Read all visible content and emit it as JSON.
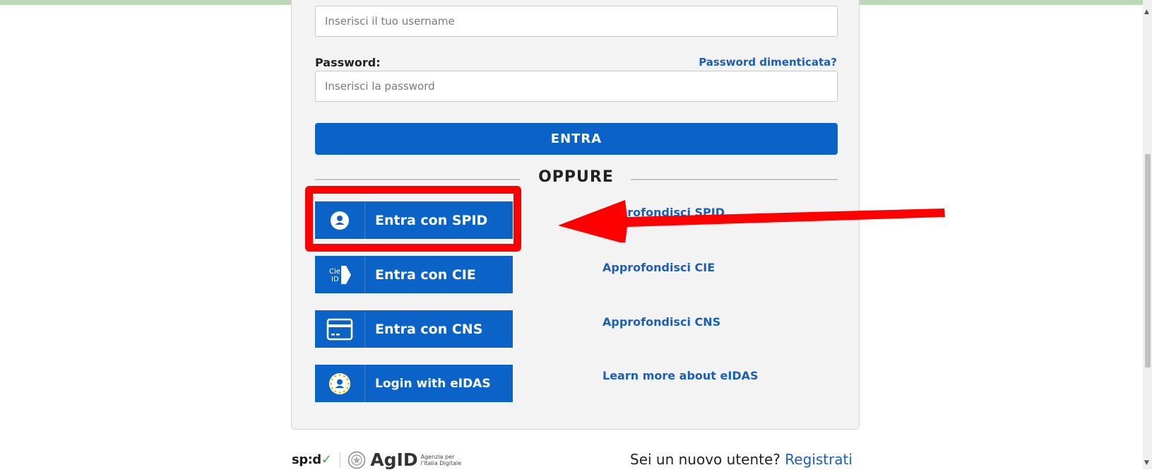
{
  "login_form": {
    "username_placeholder": "Inserisci il tuo username",
    "password_label": "Password:",
    "forgot_password_link": "Password dimenticata?",
    "password_placeholder": "Inserisci la password",
    "submit_label": "ENTRA",
    "divider_text": "OPPURE"
  },
  "identity_options": [
    {
      "button_label": "Entra con SPID",
      "icon": "spid-user-icon",
      "info_link": "Approfondisci SPID"
    },
    {
      "button_label": "Entra con CIE",
      "icon": "cie-id-icon",
      "info_link": "Approfondisci CIE"
    },
    {
      "button_label": "Entra con CNS",
      "icon": "card-icon",
      "info_link": "Approfondisci CNS"
    },
    {
      "button_label": "Login with eIDAS",
      "icon": "eidas-user-icon",
      "info_link": "Learn more about eIDAS"
    }
  ],
  "annotation": {
    "highlight_color": "#ff0000",
    "highlights": "Entra con SPID"
  },
  "footer": {
    "spid_logo": "sp:d",
    "agid_logo": "AgID",
    "agid_subtitle_line1": "Agenzia per",
    "agid_subtitle_line2": "l'Italia Digitale",
    "new_user_text": "Sei un nuovo utente?",
    "register_link": "Registrati"
  },
  "colors": {
    "primary_blue": "#0b63c8",
    "link_blue": "#1d5fb4",
    "card_bg": "#f3f3f3"
  }
}
